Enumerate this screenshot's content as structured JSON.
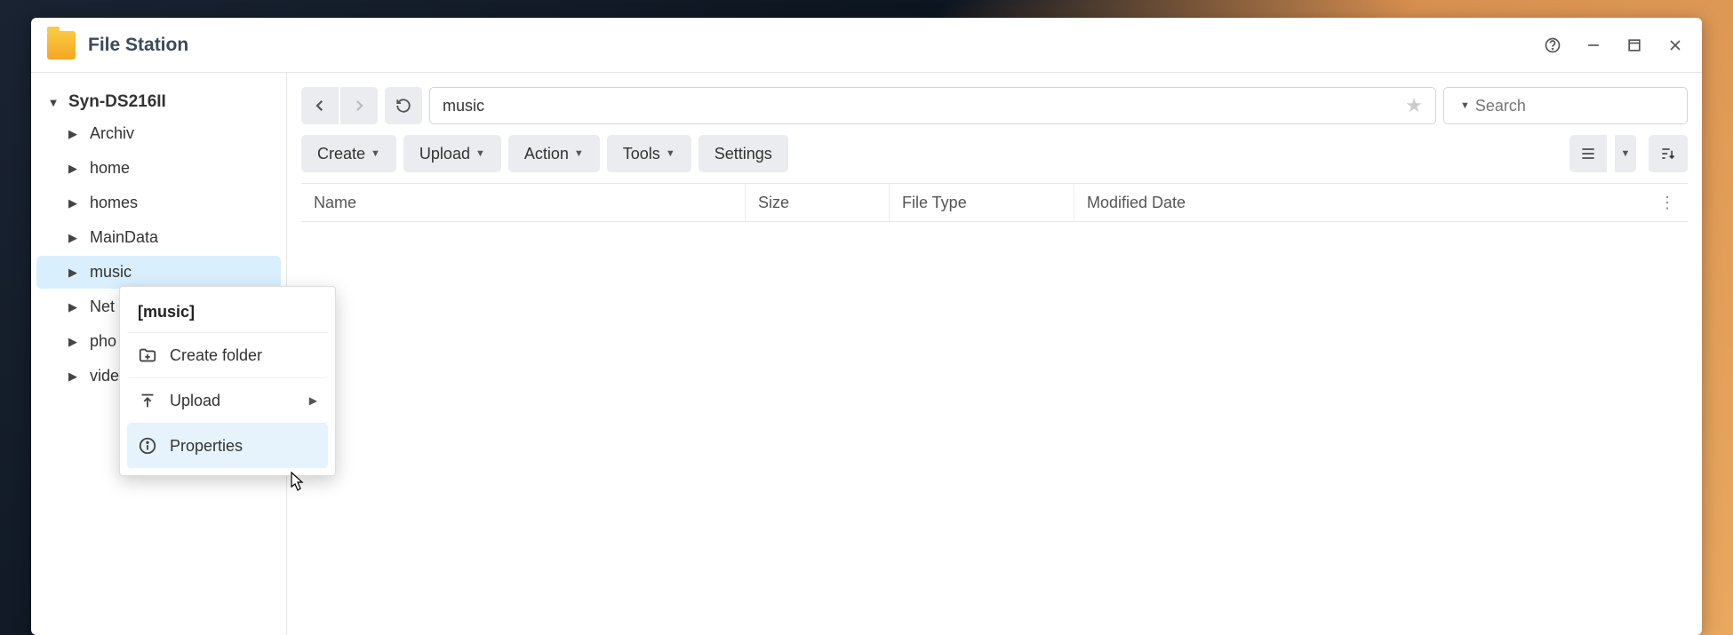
{
  "window": {
    "title": "File Station"
  },
  "sidebar": {
    "root": "Syn-DS216II",
    "items": [
      {
        "label": "Archiv"
      },
      {
        "label": "home"
      },
      {
        "label": "homes"
      },
      {
        "label": "MainData"
      },
      {
        "label": "music",
        "selected": true
      },
      {
        "label": "Net"
      },
      {
        "label": "pho"
      },
      {
        "label": "vide"
      }
    ]
  },
  "path": "music",
  "search": {
    "placeholder": "Search"
  },
  "toolbar": {
    "create": "Create",
    "upload": "Upload",
    "action": "Action",
    "tools": "Tools",
    "settings": "Settings"
  },
  "columns": {
    "name": "Name",
    "size": "Size",
    "type": "File Type",
    "modified": "Modified Date"
  },
  "context_menu": {
    "header": "[music]",
    "create_folder": "Create folder",
    "upload": "Upload",
    "properties": "Properties"
  }
}
